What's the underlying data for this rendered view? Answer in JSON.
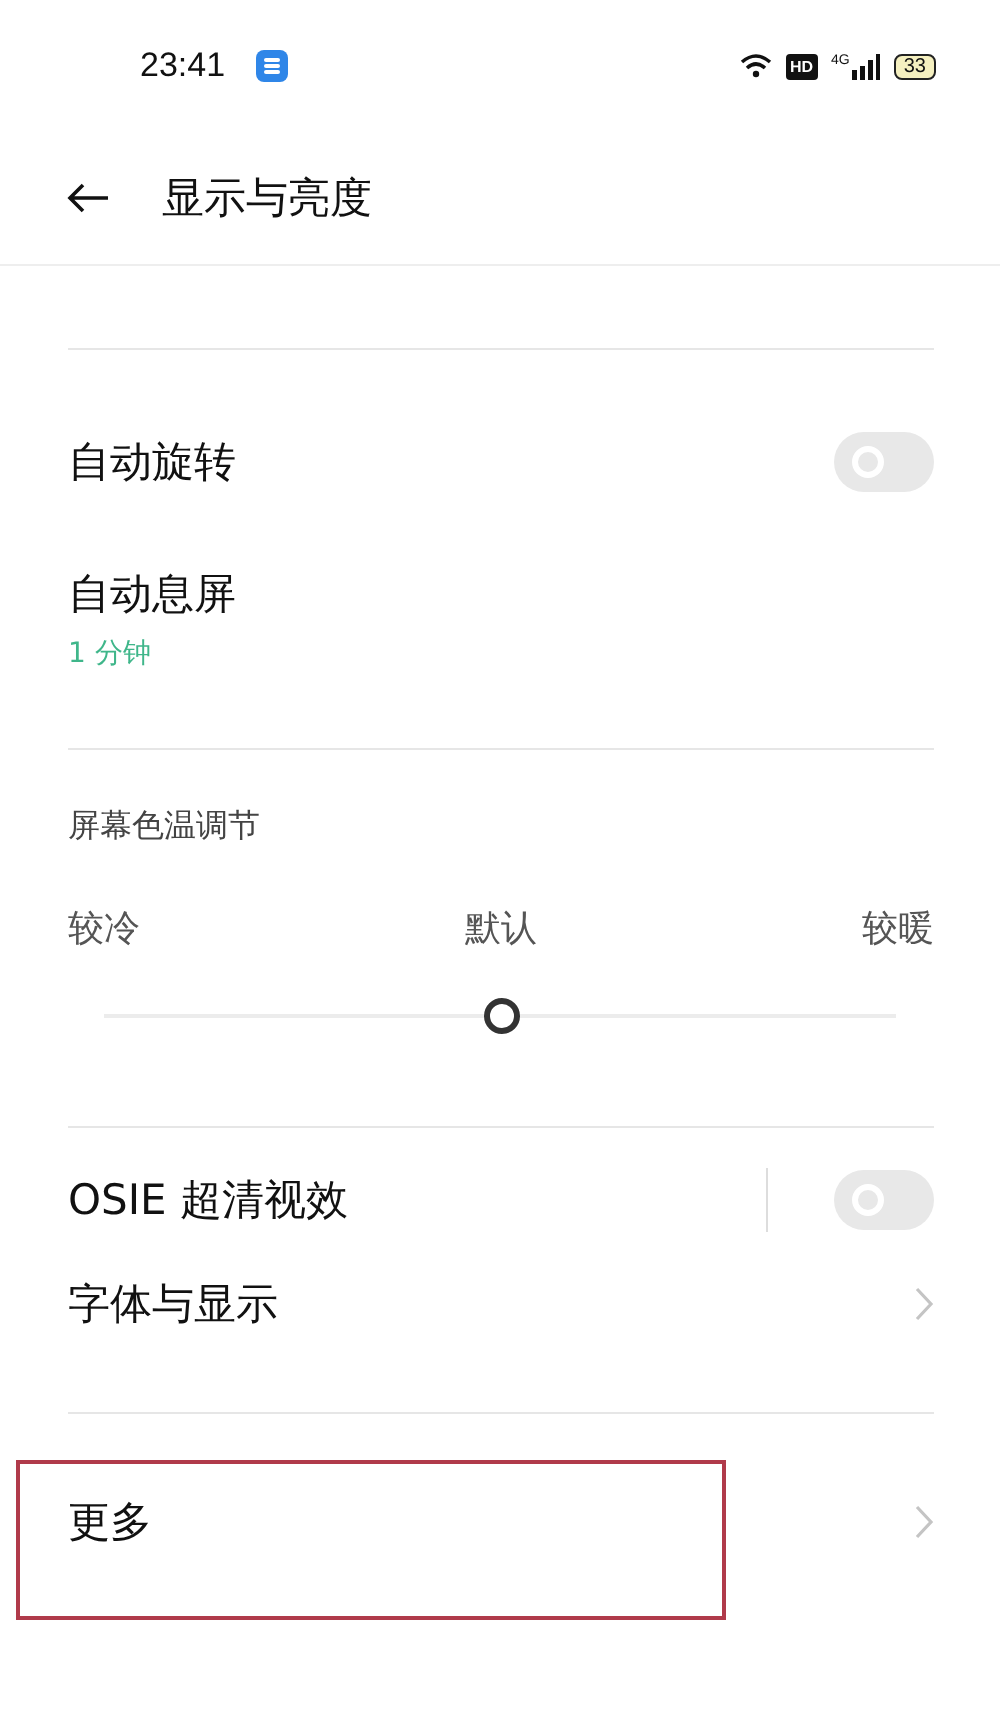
{
  "status_bar": {
    "time": "23:41",
    "hd": "HD",
    "network": "4G",
    "battery": "33"
  },
  "header": {
    "title": "显示与亮度"
  },
  "groups": [
    {
      "items": [
        {
          "kind": "toggle",
          "title": "自动旋转",
          "on": false,
          "separator": false
        },
        {
          "kind": "value",
          "title": "自动息屏",
          "value": "1 分钟"
        }
      ]
    },
    {
      "items": [
        {
          "kind": "slider",
          "title": "屏幕色温调节",
          "labels": [
            "较冷",
            "默认",
            "较暖"
          ],
          "level": 0.5
        }
      ]
    },
    {
      "items": [
        {
          "kind": "toggle",
          "title": "OSIE 超清视效",
          "on": false,
          "separator": true
        },
        {
          "kind": "link",
          "title": "字体与显示",
          "highlighted": false
        }
      ]
    },
    {
      "items": [
        {
          "kind": "link",
          "title": "更多",
          "highlighted": true
        }
      ]
    }
  ]
}
